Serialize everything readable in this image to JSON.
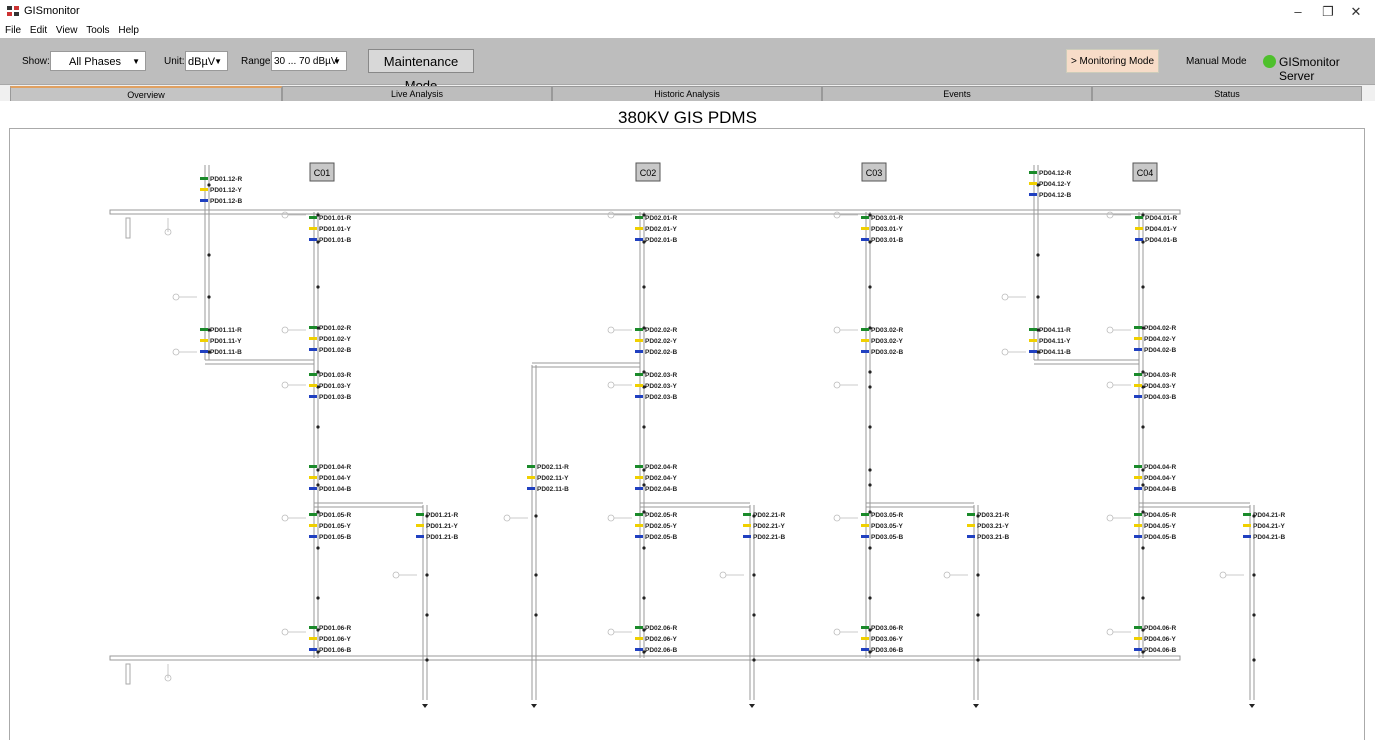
{
  "window": {
    "title": "GISmonitor",
    "minimize": "–",
    "restore": "❐",
    "close": "✕"
  },
  "menu": [
    "File",
    "Edit",
    "View",
    "Tools",
    "Help"
  ],
  "toolbar": {
    "show_label": "Show:",
    "show_value": "All Phases",
    "unit_label": "Unit:",
    "unit_value": "dBµV",
    "range_label": "Range:",
    "range_value": "30 ... 70 dBµV",
    "maintenance_button": "Maintenance Mode",
    "monitoring_button": ">  Monitoring Mode",
    "manual_mode": "Manual Mode",
    "server_status": "GISmonitor Server",
    "server_color": "#4ec02c"
  },
  "tabs": [
    "Overview",
    "Live Analysis",
    "Historic Analysis",
    "Events",
    "Status"
  ],
  "active_tab": "Overview",
  "page_title": "380KV GIS PDMS",
  "colors": {
    "R": "#1a8a2a",
    "Y": "#f0d000",
    "B": "#2040c0"
  },
  "bays": [
    "C01",
    "C02",
    "C03",
    "C04"
  ],
  "sensor_groups": [
    {
      "id": "PD01.12",
      "labels": [
        "PD01.12-R",
        "PD01.12-Y",
        "PD01.12-B"
      ]
    },
    {
      "id": "PD01.01",
      "labels": [
        "PD01.01-R",
        "PD01.01-Y",
        "PD01.01-B"
      ]
    },
    {
      "id": "PD01.11",
      "labels": [
        "PD01.11-R",
        "PD01.11-Y",
        "PD01.11-B"
      ]
    },
    {
      "id": "PD01.02",
      "labels": [
        "PD01.02-R",
        "PD01.02-Y",
        "PD01.02-B"
      ]
    },
    {
      "id": "PD01.03",
      "labels": [
        "PD01.03-R",
        "PD01.03-Y",
        "PD01.03-B"
      ]
    },
    {
      "id": "PD01.04",
      "labels": [
        "PD01.04-R",
        "PD01.04-Y",
        "PD01.04-B"
      ]
    },
    {
      "id": "PD01.05",
      "labels": [
        "PD01.05-R",
        "PD01.05-Y",
        "PD01.05-B"
      ]
    },
    {
      "id": "PD01.21",
      "labels": [
        "PD01.21-R",
        "PD01.21-Y",
        "PD01.21-B"
      ]
    },
    {
      "id": "PD01.06",
      "labels": [
        "PD01.06-R",
        "PD01.06-Y",
        "PD01.06-B"
      ]
    },
    {
      "id": "PD02.01",
      "labels": [
        "PD02.01-R",
        "PD02.01-Y",
        "PD02.01-B"
      ]
    },
    {
      "id": "PD02.02",
      "labels": [
        "PD02.02-R",
        "PD02.02-Y",
        "PD02.02-B"
      ]
    },
    {
      "id": "PD02.03",
      "labels": [
        "PD02.03-R",
        "PD02.03-Y",
        "PD02.03-B"
      ]
    },
    {
      "id": "PD02.11",
      "labels": [
        "PD02.11-R",
        "PD02.11-Y",
        "PD02.11-B"
      ]
    },
    {
      "id": "PD02.04",
      "labels": [
        "PD02.04-R",
        "PD02.04-Y",
        "PD02.04-B"
      ]
    },
    {
      "id": "PD02.05",
      "labels": [
        "PD02.05-R",
        "PD02.05-Y",
        "PD02.05-B"
      ]
    },
    {
      "id": "PD02.21",
      "labels": [
        "PD02.21-R",
        "PD02.21-Y",
        "PD02.21-B"
      ]
    },
    {
      "id": "PD02.06",
      "labels": [
        "PD02.06-R",
        "PD02.06-Y",
        "PD02.06-B"
      ]
    },
    {
      "id": "PD03.01",
      "labels": [
        "PD03.01-R",
        "PD03.01-Y",
        "PD03.01-B"
      ]
    },
    {
      "id": "PD03.02",
      "labels": [
        "PD03.02-R",
        "PD03.02-Y",
        "PD03.02-B"
      ]
    },
    {
      "id": "PD03.05",
      "labels": [
        "PD03.05-R",
        "PD03.05-Y",
        "PD03.05-B"
      ]
    },
    {
      "id": "PD03.21",
      "labels": [
        "PD03.21-R",
        "PD03.21-Y",
        "PD03.21-B"
      ]
    },
    {
      "id": "PD03.06",
      "labels": [
        "PD03.06-R",
        "PD03.06-Y",
        "PD03.06-B"
      ]
    },
    {
      "id": "PD04.12",
      "labels": [
        "PD04.12-R",
        "PD04.12-Y",
        "PD04.12-B"
      ]
    },
    {
      "id": "PD04.01",
      "labels": [
        "PD04.01-R",
        "PD04.01-Y",
        "PD04.01-B"
      ]
    },
    {
      "id": "PD04.11",
      "labels": [
        "PD04.11-R",
        "PD04.11-Y",
        "PD04.11-B"
      ]
    },
    {
      "id": "PD04.02",
      "labels": [
        "PD04.02-R",
        "PD04.02-Y",
        "PD04.02-B"
      ]
    },
    {
      "id": "PD04.03",
      "labels": [
        "PD04.03-R",
        "PD04.03-Y",
        "PD04.03-B"
      ]
    },
    {
      "id": "PD04.04",
      "labels": [
        "PD04.04-R",
        "PD04.04-Y",
        "PD04.04-B"
      ]
    },
    {
      "id": "PD04.05",
      "labels": [
        "PD04.05-R",
        "PD04.05-Y",
        "PD04.05-B"
      ]
    },
    {
      "id": "PD04.21",
      "labels": [
        "PD04.21-R",
        "PD04.21-Y",
        "PD04.21-B"
      ]
    },
    {
      "id": "PD04.06",
      "labels": [
        "PD04.06-R",
        "PD04.06-Y",
        "PD04.06-B"
      ]
    }
  ]
}
